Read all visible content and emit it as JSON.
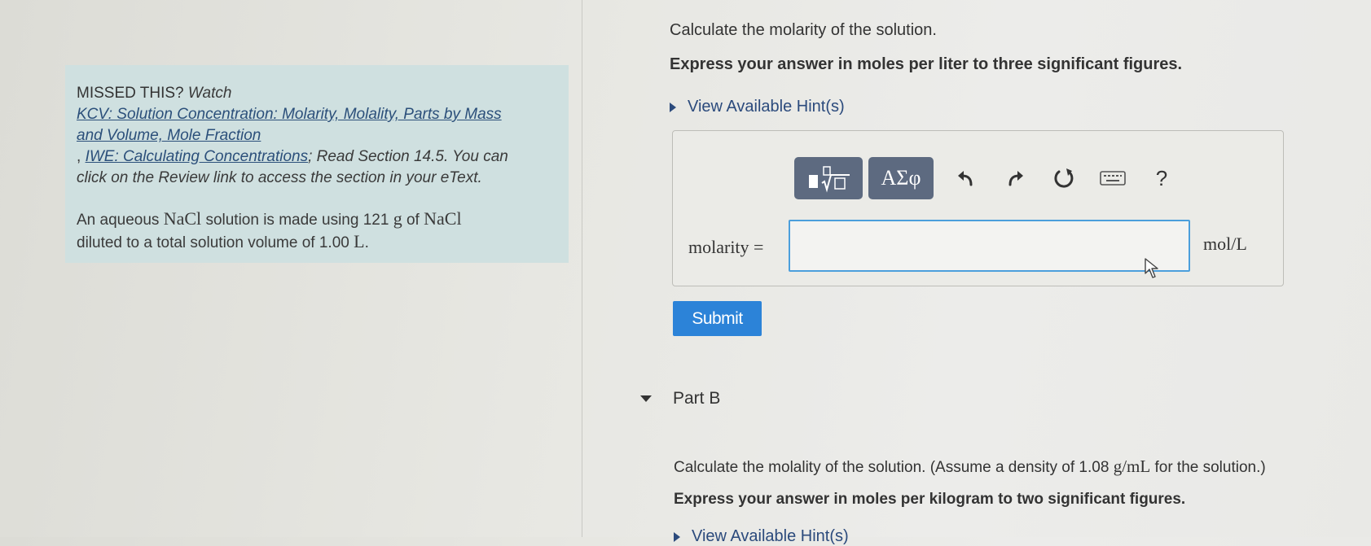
{
  "left_panel": {
    "missed_label": "MISSED THIS?",
    "watch_label": "Watch",
    "link1_line1": "KCV: Solution Concentration: Molarity, Molality, Parts by Mass",
    "link1_line2": "and Volume, Mole Fraction",
    "link2_prefix": ",",
    "link2": "IWE: Calculating Concentrations",
    "read_text": "; Read Section 14.5. You can",
    "review_text": "click on the Review link to access the section in your eText.",
    "problem_line1_a": "An aqueous",
    "problem_nacl_1": "NaCl",
    "problem_line1_b": "solution is made using 121",
    "problem_g": "g",
    "problem_of": "of",
    "problem_nacl_2": "NaCl",
    "problem_line2_a": "diluted to a total solution volume of 1.00",
    "problem_l": "L",
    "problem_period": "."
  },
  "part_a": {
    "question": "Calculate the molarity of the solution.",
    "instruction": "Express your answer in moles per liter to three significant figures.",
    "hints_label": "View Available Hint(s)",
    "toolbar": {
      "templates_icon": "templates-icon",
      "symbols_label": "ΑΣφ",
      "undo_icon": "undo-icon",
      "redo_icon": "redo-icon",
      "reset_icon": "reset-icon",
      "keyboard_icon": "keyboard-icon",
      "help_label": "?"
    },
    "answer_label": "molarity =",
    "answer_value": "",
    "unit_label": "mol/L",
    "submit_label": "Submit"
  },
  "part_b": {
    "title": "Part B",
    "question_a": "Calculate the molality of the solution. (Assume a density of 1.08",
    "question_unit": "g/mL",
    "question_b": "for the solution.)",
    "instruction": "Express your answer in moles per kilogram to two significant figures.",
    "hints_label": "View Available Hint(s)"
  },
  "colors": {
    "panel_bg": "#cfe0e0",
    "link": "#2b4f7a",
    "accent": "#2c83d8",
    "toolbar_btn": "#5d6a80",
    "input_border": "#4b9fdc"
  }
}
